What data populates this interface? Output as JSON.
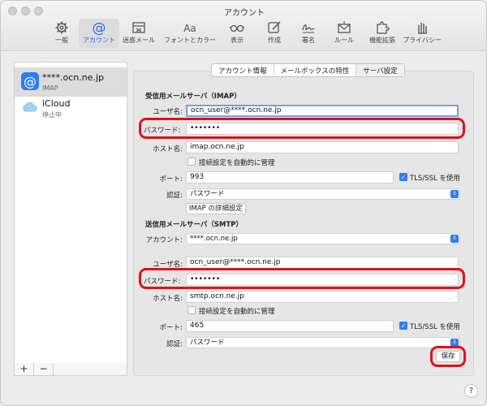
{
  "window": {
    "title": "アカウント"
  },
  "toolbar": {
    "items": [
      {
        "label": "一般",
        "icon": "gear-icon"
      },
      {
        "label": "アカウント",
        "icon": "at-sign-icon",
        "active": true
      },
      {
        "label": "迷惑メール",
        "icon": "junk-mail-icon"
      },
      {
        "label": "フォントとカラー",
        "icon": "font-icon",
        "glyph": "Aa"
      },
      {
        "label": "表示",
        "icon": "glasses-icon"
      },
      {
        "label": "作成",
        "icon": "compose-icon"
      },
      {
        "label": "署名",
        "icon": "signature-icon"
      },
      {
        "label": "ルール",
        "icon": "rules-icon"
      },
      {
        "label": "機能拡張",
        "icon": "extensions-icon"
      },
      {
        "label": "プライバシー",
        "icon": "privacy-hand-icon"
      }
    ]
  },
  "sidebar": {
    "accounts": [
      {
        "name": "****.ocn.ne.jp",
        "sub": "IMAP",
        "selected": true
      },
      {
        "name": "iCloud",
        "sub": "停止中",
        "selected": false
      }
    ],
    "add": "+",
    "remove": "−"
  },
  "tabs": [
    "アカウント情報",
    "メールボックスの特性",
    "サーバ設定"
  ],
  "incoming": {
    "section": "受信用メールサーバ（IMAP）",
    "username_label": "ユーザ名:",
    "username": "ocn_user@****.ocn.ne.jp",
    "password_label": "パスワード:",
    "password": "•••••••",
    "host_label": "ホスト名:",
    "host": "imap.ocn.ne.jp",
    "auto_manage": "接続設定を自動的に管理",
    "port_label": "ポート:",
    "port": "993",
    "tls_label": "TLS/SSL を使用",
    "auth_label": "認証:",
    "auth": "パスワード",
    "advanced_button": "IMAP の詳細設定"
  },
  "outgoing": {
    "section": "送信用メールサーバ（SMTP）",
    "account_label": "アカウント:",
    "account": "****.ocn.ne.jp",
    "username_label": "ユーザ名:",
    "username": "ocn_user@****.ocn.ne.jp",
    "password_label": "パスワード:",
    "password": "•••••••",
    "host_label": "ホスト名:",
    "host": "smtp.ocn.ne.jp",
    "auto_manage": "接続設定を自動的に管理",
    "port_label": "ポート:",
    "port": "465",
    "tls_label": "TLS/SSL を使用",
    "auth_label": "認証:",
    "auth": "パスワード"
  },
  "save_button": "保存",
  "help": "?",
  "colors": {
    "accent": "#2f7cf6",
    "highlight_ring": "#e0101a"
  }
}
